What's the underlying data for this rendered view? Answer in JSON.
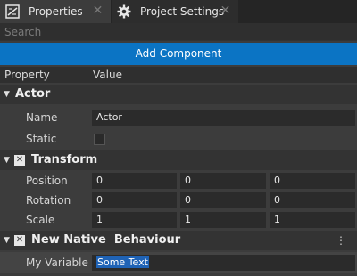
{
  "tabs": [
    {
      "label": "Properties",
      "icon": "properties-icon",
      "active": true
    },
    {
      "label": "Project Settings",
      "icon": "gear-icon",
      "active": false
    }
  ],
  "search": {
    "placeholder": "Search"
  },
  "add_component": {
    "label": "Add Component"
  },
  "columns": {
    "property": "Property",
    "value": "Value"
  },
  "actor": {
    "title": "Actor",
    "name_label": "Name",
    "name_value": "Actor",
    "static_label": "Static",
    "static_checked": false
  },
  "transform": {
    "title": "Transform",
    "position_label": "Position",
    "position": [
      "0",
      "0",
      "0"
    ],
    "rotation_label": "Rotation",
    "rotation": [
      "0",
      "0",
      "0"
    ],
    "scale_label": "Scale",
    "scale": [
      "1",
      "1",
      "1"
    ]
  },
  "behaviour": {
    "title": "New Native  Behaviour",
    "var_label": "My Variable",
    "var_value": "Some Text"
  },
  "colors": {
    "accent": "#0b74c4",
    "selection": "#1f63b6",
    "panel": "#3c3c3c"
  }
}
